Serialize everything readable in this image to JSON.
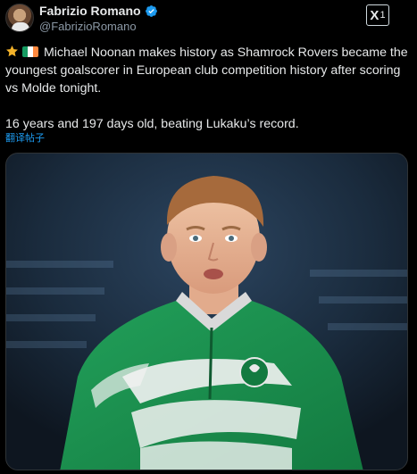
{
  "author": {
    "name": "Fabrizio Romano",
    "handle": "@FabrizioRomano",
    "verified": true,
    "avatar_icon": "profile-photo"
  },
  "header_button": {
    "label": "X",
    "suffix": "1"
  },
  "tweet": {
    "line1": " Michael Noonan makes history as Shamrock Rovers became the",
    "line2": "youngest goalscorer in European club competition history after scoring",
    "line3": "vs Molde tonight.",
    "line4": "16 years and 197 days old, beating Lukaku’s record.",
    "emojis": [
      "star-emoji",
      "ireland-flag-emoji"
    ]
  },
  "translate_link": "翻译帖子",
  "media": {
    "description_icon": "player-photo",
    "colors": {
      "kit_green": "#1f8a4c",
      "kit_white": "#f2f2f2"
    }
  },
  "colors": {
    "background": "#000000",
    "text": "#e7e9ea",
    "muted": "#8b98a5",
    "link": "#1d9bf0",
    "verified": "#1d9bf0"
  }
}
